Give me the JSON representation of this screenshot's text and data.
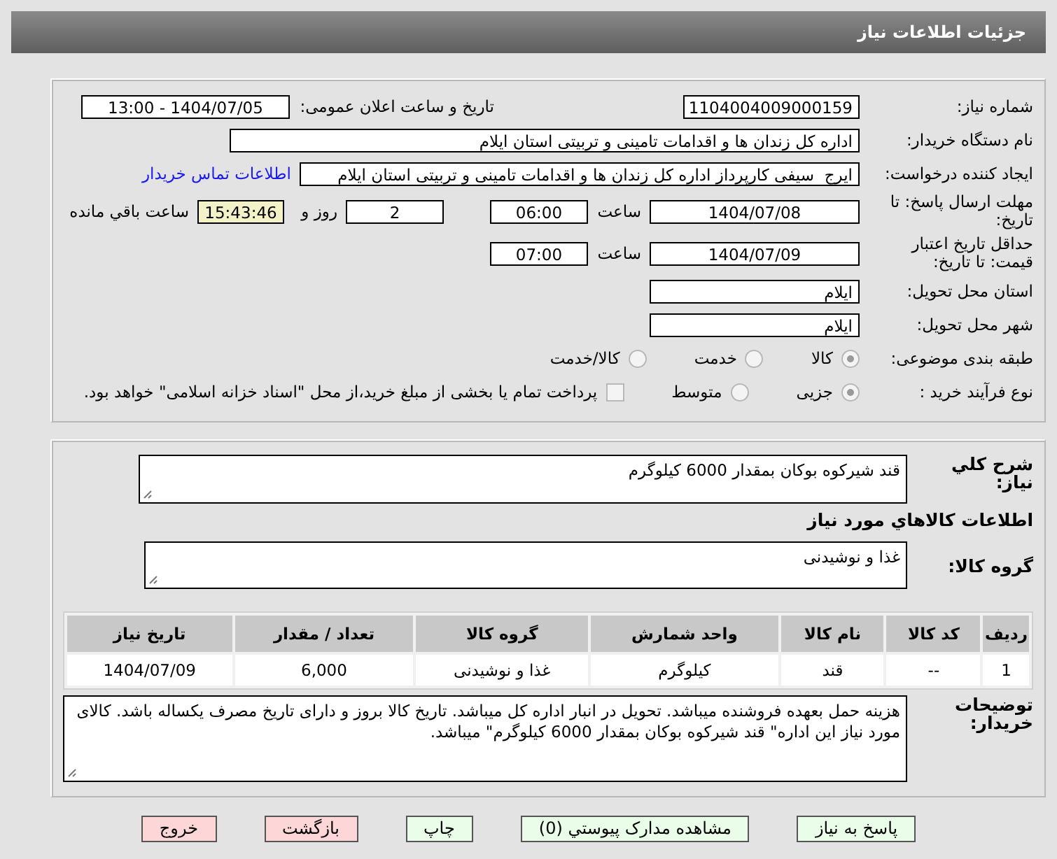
{
  "header": {
    "title": "جزئیات اطلاعات نیاز"
  },
  "need_number": {
    "label": "شماره نیاز:",
    "value": "1104004009000159"
  },
  "announce": {
    "label": "تاریخ و ساعت اعلان عمومی:",
    "value": "1404/07/05 - 13:00"
  },
  "buyer": {
    "label": "نام دستگاه خریدار:",
    "value": "اداره کل زندان ها و اقدامات تامینی و تربیتی استان ایلام"
  },
  "creator": {
    "label": "ایجاد کننده درخواست:",
    "value": "ایرج  سیفی کارپرداز اداره کل زندان ها و اقدامات تامینی و تربیتی استان ایلام",
    "link": "اطلاعات تماس خریدار"
  },
  "deadline": {
    "label": "مهلت ارسال پاسخ: تا تاریخ:",
    "date": "1404/07/08",
    "time_label": "ساعت",
    "time": "06:00",
    "days": "2",
    "days_label": "روز و",
    "remaining": "15:43:46",
    "remaining_label": "ساعت باقي مانده"
  },
  "validity": {
    "label": "حداقل تاریخ اعتبار قیمت: تا تاریخ:",
    "date": "1404/07/09",
    "time_label": "ساعت",
    "time": "07:00"
  },
  "province": {
    "label": "استان محل تحویل:",
    "value": "ایلام"
  },
  "city": {
    "label": "شهر محل تحویل:",
    "value": "ایلام"
  },
  "category": {
    "label": "طبقه بندی موضوعی:",
    "options": [
      {
        "label": "کالا",
        "selected": true
      },
      {
        "label": "خدمت",
        "selected": false
      },
      {
        "label": "کالا/خدمت",
        "selected": false
      }
    ]
  },
  "process": {
    "label": "نوع فرآیند خرید :",
    "options": [
      {
        "label": "جزیی",
        "selected": true
      },
      {
        "label": "متوسط",
        "selected": false
      }
    ],
    "checkbox": {
      "label": "پرداخت تمام یا بخشی از مبلغ خرید،از محل \"اسناد خزانه اسلامی\" خواهد بود.",
      "checked": false
    }
  },
  "description": {
    "label": "شرح کلي نياز:",
    "value": "قند شیرکوه بوکان بمقدار 6000 کیلوگرم"
  },
  "goods_title": "اطلاعات کالاهاي مورد نياز",
  "goods_group": {
    "label": "گروه کالا:",
    "value": "غذا و نوشیدنی"
  },
  "table": {
    "columns": [
      "ردیف",
      "کد کالا",
      "نام کالا",
      "واحد شمارش",
      "گروه کالا",
      "تعداد / مقدار",
      "تاریخ نیاز"
    ],
    "rows": [
      [
        "1",
        "--",
        "قند",
        "کیلوگرم",
        "غذا و نوشیدنی",
        "6,000",
        "1404/07/09"
      ]
    ]
  },
  "notes": {
    "label": "توضیحات خریدار:",
    "value": "هزینه حمل بعهده فروشنده میباشد. تحویل در انبار اداره کل میباشد. تاریخ کالا بروز و دارای تاریخ مصرف یکساله باشد. کالای مورد نیاز این اداره\" قند شیرکوه بوکان بمقدار 6000 کیلوگرم\" میباشد."
  },
  "buttons": [
    {
      "label": "پاسخ به نیاز",
      "kind": "green"
    },
    {
      "label": "مشاهده مدارک پیوستي (0)",
      "kind": "green"
    },
    {
      "label": "چاپ",
      "kind": "green"
    },
    {
      "label": "بازگشت",
      "kind": "red"
    },
    {
      "label": "خروج",
      "kind": "red"
    }
  ]
}
